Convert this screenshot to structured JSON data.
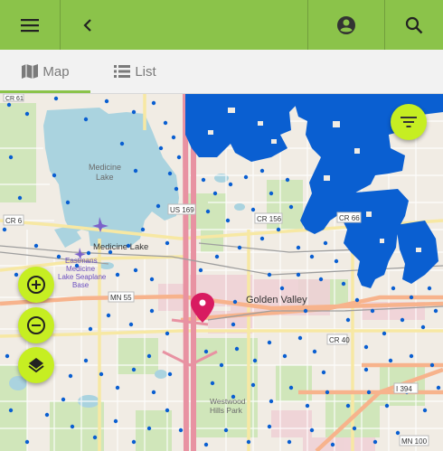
{
  "appbar": {
    "background": "#8bc34a",
    "icons": [
      "menu-icon",
      "back-arrow-icon",
      "account-icon",
      "search-icon"
    ]
  },
  "tabs": [
    {
      "label": "Map",
      "icon": "map-icon",
      "active": true
    },
    {
      "label": "List",
      "icon": "list-icon",
      "active": false
    }
  ],
  "map": {
    "labels": {
      "medicine_lake_water": "Medicine\nLake",
      "medicine_lake_city": "Medicine Lake",
      "seaplane_base": "Eastmans\nMedicine\nLake Seaplane\nBase",
      "golden_valley": "Golden Valley",
      "westwood_hills_park": "Westwood\nHills Park",
      "us169": "US 169",
      "cr6": "CR 6",
      "cr156": "CR 156",
      "cr66": "CR 66",
      "cr40": "CR 40",
      "mn55": "MN 55",
      "i394": "I 394",
      "mn100": "MN 100",
      "cr61": "CR 61"
    },
    "marker_color": "#0a5fd1",
    "pin_color": "#d81b60"
  },
  "controls": {
    "fab_color": "#c6ee22",
    "buttons": [
      "filter-icon",
      "zoom-in-icon",
      "zoom-out-icon",
      "layers-icon"
    ]
  }
}
